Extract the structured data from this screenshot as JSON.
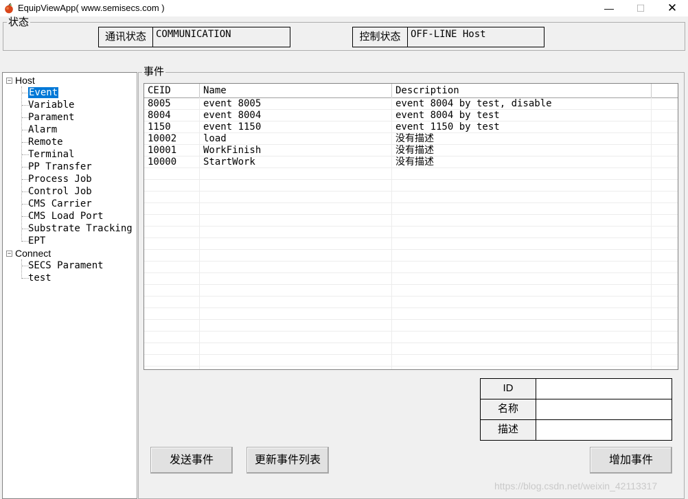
{
  "window": {
    "title": "EquipViewApp( www.semisecs.com )",
    "minimize": "—",
    "maximize": "☐",
    "close": "✕"
  },
  "status": {
    "legend": "状态",
    "comm_label": "通讯状态",
    "comm_value": "COMMUNICATION",
    "control_label": "控制状态",
    "control_value": "OFF-LINE Host"
  },
  "tree": {
    "host": "Host",
    "host_children": [
      "Event",
      "Variable",
      "Parament",
      "Alarm",
      "Remote",
      "Terminal",
      "PP Transfer",
      "Process Job",
      "Control Job",
      "CMS Carrier",
      "CMS Load Port",
      "Substrate Tracking",
      "EPT"
    ],
    "connect": "Connect",
    "connect_children": [
      "SECS Parament",
      "test"
    ],
    "expander": "−"
  },
  "event_panel": {
    "legend": "事件",
    "columns": [
      "CEID",
      "Name",
      "Description"
    ],
    "rows": [
      [
        "8005",
        "event 8005",
        "event 8004 by test, disable"
      ],
      [
        "8004",
        "event 8004",
        "event 8004 by test"
      ],
      [
        "1150",
        "event 1150",
        "event 1150 by test"
      ],
      [
        "10002",
        "load",
        "没有描述"
      ],
      [
        "10001",
        "WorkFinish",
        "没有描述"
      ],
      [
        "10000",
        "StartWork",
        "没有描述"
      ]
    ]
  },
  "form": {
    "id_label": "ID",
    "id_value": "",
    "name_label": "名称",
    "name_value": "",
    "desc_label": "描述",
    "desc_value": ""
  },
  "buttons": {
    "send": "发送事件",
    "refresh": "更新事件列表",
    "add": "增加事件"
  },
  "watermark": "https://blog.csdn.net/weixin_42113317",
  "colors": {
    "selection": "#0078d7",
    "background": "#f0f0f0"
  }
}
